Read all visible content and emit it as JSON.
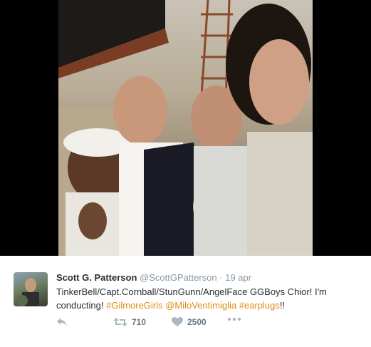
{
  "tweet": {
    "author_name": "Scott G. Patterson",
    "author_handle": "@ScottGPatterson",
    "separator": "·",
    "timestamp": "19 apr",
    "text_plain": "TinkerBell/Capt.Cornball/StunGunn/AngelFace GGBoys Chior! I'm conducting! ",
    "hashtags": [
      "#GilmoreGirls",
      "@MiloVentimiglia",
      "#earplugs"
    ],
    "text_end": "!!",
    "retweet_count": "710",
    "like_count": "2500"
  },
  "icons": {
    "reply": "reply-icon",
    "retweet": "retweet-icon",
    "like": "heart-icon",
    "more": "more-icon"
  },
  "colors": {
    "hashtag": "#e28a14",
    "name": "#292f33",
    "muted": "#8899a6"
  }
}
